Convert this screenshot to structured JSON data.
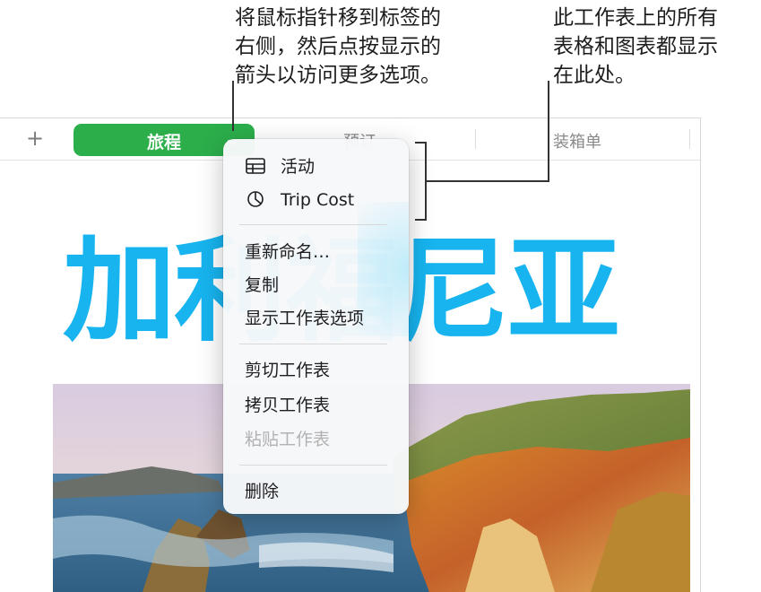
{
  "callouts": {
    "left": [
      "将鼠标指针移到标签的",
      "右侧，然后点按显示的",
      "箭头以访问更多选项。"
    ],
    "right": [
      "此工作表上的所有",
      "表格和图表都显示",
      "在此处。"
    ]
  },
  "tabbar": {
    "add_label": "+",
    "active_tab": "旅程",
    "tabs": [
      "预订",
      "装箱单"
    ]
  },
  "sheet": {
    "title": "加利福尼亚"
  },
  "menu": {
    "objects": [
      {
        "label": "活动",
        "icon": "table-icon"
      },
      {
        "label": "Trip Cost",
        "icon": "chart-icon"
      }
    ],
    "group2": [
      "重新命名…",
      "复制",
      "显示工作表选项"
    ],
    "group3": [
      "剪切工作表",
      "拷贝工作表",
      "粘贴工作表"
    ],
    "group4": [
      "删除"
    ]
  },
  "colors": {
    "accent_green": "#2cae4b",
    "title_blue": "#17b4ef"
  }
}
